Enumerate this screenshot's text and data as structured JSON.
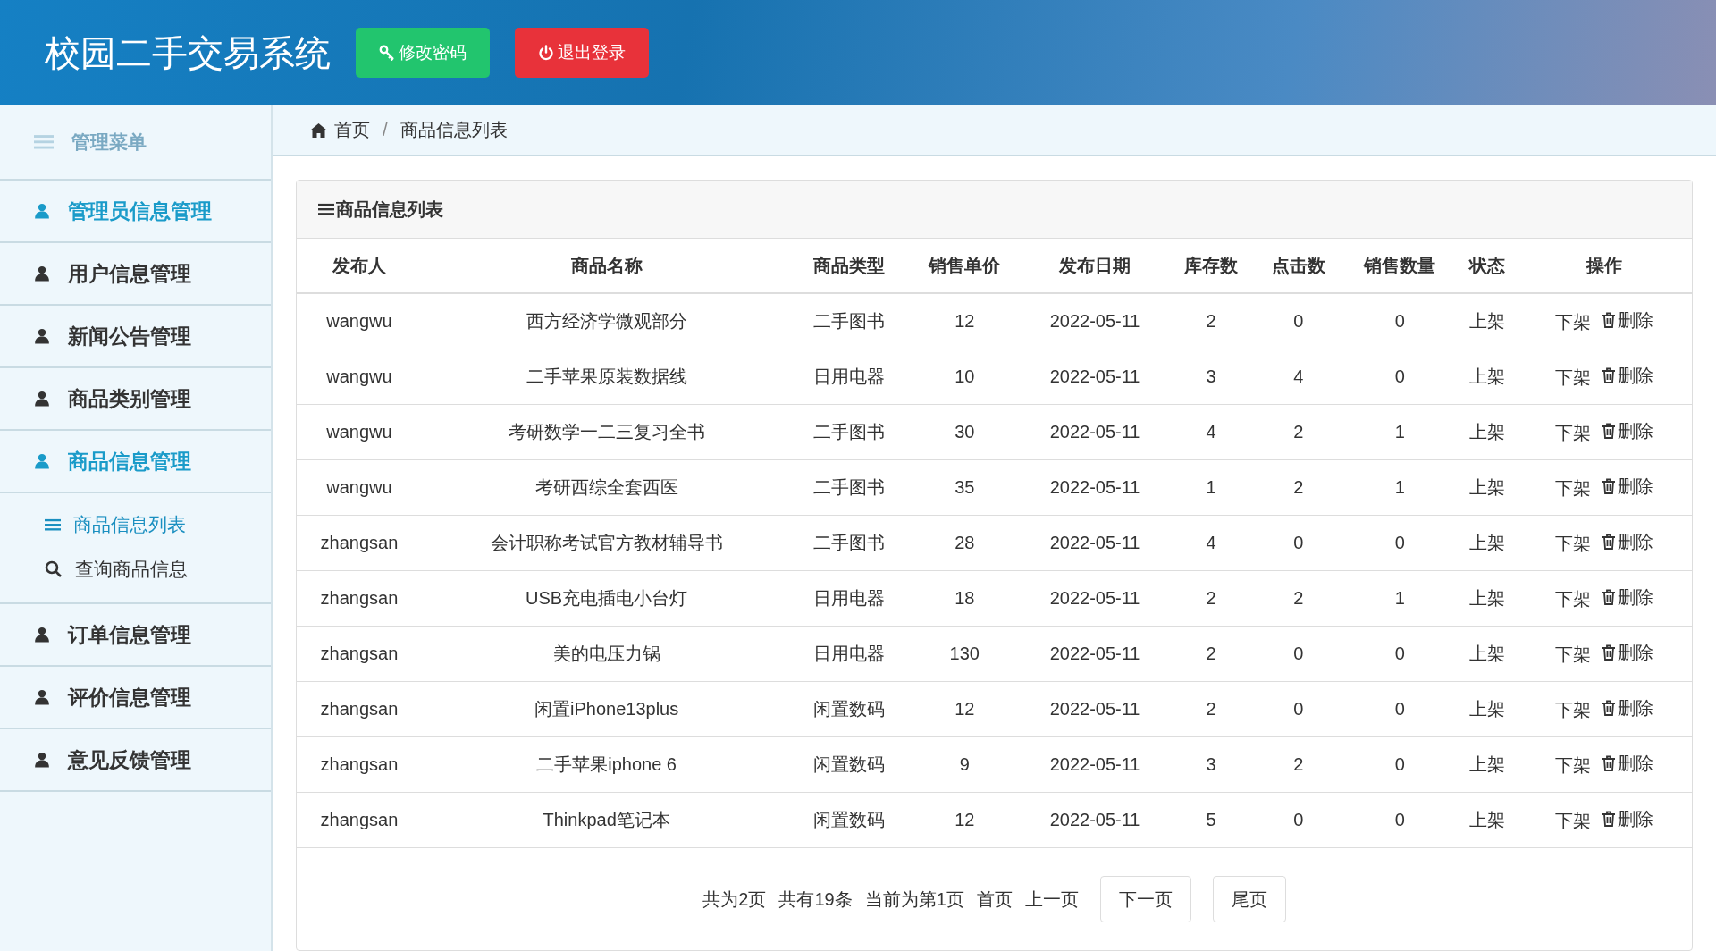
{
  "header": {
    "title": "校园二手交易系统",
    "buttons": [
      {
        "kind": "password",
        "label": "修改密码"
      },
      {
        "kind": "logout",
        "label": "退出登录"
      }
    ]
  },
  "sidebar": {
    "title": "管理菜单",
    "items": [
      {
        "label": "管理员信息管理",
        "highlighted": true
      },
      {
        "label": "用户信息管理",
        "highlighted": false
      },
      {
        "label": "新闻公告管理",
        "highlighted": false
      },
      {
        "label": "商品类别管理",
        "highlighted": false
      },
      {
        "label": "商品信息管理",
        "highlighted": true,
        "children": [
          {
            "kind": "list",
            "label": "商品信息列表",
            "selected": true
          },
          {
            "kind": "search",
            "label": "查询商品信息",
            "selected": false
          }
        ]
      },
      {
        "label": "订单信息管理",
        "highlighted": false
      },
      {
        "label": "评价信息管理",
        "highlighted": false
      },
      {
        "label": "意见反馈管理",
        "highlighted": false
      }
    ]
  },
  "breadcrumb": {
    "items": [
      "首页",
      "商品信息列表"
    ],
    "separator": "/"
  },
  "panel": {
    "title": "商品信息列表"
  },
  "table": {
    "columns": [
      "发布人",
      "商品名称",
      "商品类型",
      "销售单价",
      "发布日期",
      "库存数",
      "点击数",
      "销售数量",
      "状态",
      "操作"
    ],
    "rows": [
      {
        "cells": [
          "wangwu",
          "西方经济学微观部分",
          "二手图书",
          "12",
          "2022-05-11",
          "2",
          "0",
          "0",
          "上架"
        ],
        "actions": [
          "下架",
          "删除"
        ]
      },
      {
        "cells": [
          "wangwu",
          "二手苹果原装数据线",
          "日用电器",
          "10",
          "2022-05-11",
          "3",
          "4",
          "0",
          "上架"
        ],
        "actions": [
          "下架",
          "删除"
        ]
      },
      {
        "cells": [
          "wangwu",
          "考研数学一二三复习全书",
          "二手图书",
          "30",
          "2022-05-11",
          "4",
          "2",
          "1",
          "上架"
        ],
        "actions": [
          "下架",
          "删除"
        ]
      },
      {
        "cells": [
          "wangwu",
          "考研西综全套西医",
          "二手图书",
          "35",
          "2022-05-11",
          "1",
          "2",
          "1",
          "上架"
        ],
        "actions": [
          "下架",
          "删除"
        ]
      },
      {
        "cells": [
          "zhangsan",
          "会计职称考试官方教材辅导书",
          "二手图书",
          "28",
          "2022-05-11",
          "4",
          "0",
          "0",
          "上架"
        ],
        "actions": [
          "下架",
          "删除"
        ]
      },
      {
        "cells": [
          "zhangsan",
          "USB充电插电小台灯",
          "日用电器",
          "18",
          "2022-05-11",
          "2",
          "2",
          "1",
          "上架"
        ],
        "actions": [
          "下架",
          "删除"
        ]
      },
      {
        "cells": [
          "zhangsan",
          "美的电压力锅",
          "日用电器",
          "130",
          "2022-05-11",
          "2",
          "0",
          "0",
          "上架"
        ],
        "actions": [
          "下架",
          "删除"
        ]
      },
      {
        "cells": [
          "zhangsan",
          "闲置iPhone13plus",
          "闲置数码",
          "12",
          "2022-05-11",
          "2",
          "0",
          "0",
          "上架"
        ],
        "actions": [
          "下架",
          "删除"
        ]
      },
      {
        "cells": [
          "zhangsan",
          "二手苹果iphone 6",
          "闲置数码",
          "9",
          "2022-05-11",
          "3",
          "2",
          "0",
          "上架"
        ],
        "actions": [
          "下架",
          "删除"
        ]
      },
      {
        "cells": [
          "zhangsan",
          "Thinkpad笔记本",
          "闲置数码",
          "12",
          "2022-05-11",
          "5",
          "0",
          "0",
          "上架"
        ],
        "actions": [
          "下架",
          "删除"
        ]
      }
    ]
  },
  "pagination": {
    "info": [
      "共为2页",
      "共有19条",
      "当前为第1页"
    ],
    "links": [
      "首页",
      "上一页"
    ],
    "buttons": [
      "下一页",
      "尾页"
    ]
  }
}
